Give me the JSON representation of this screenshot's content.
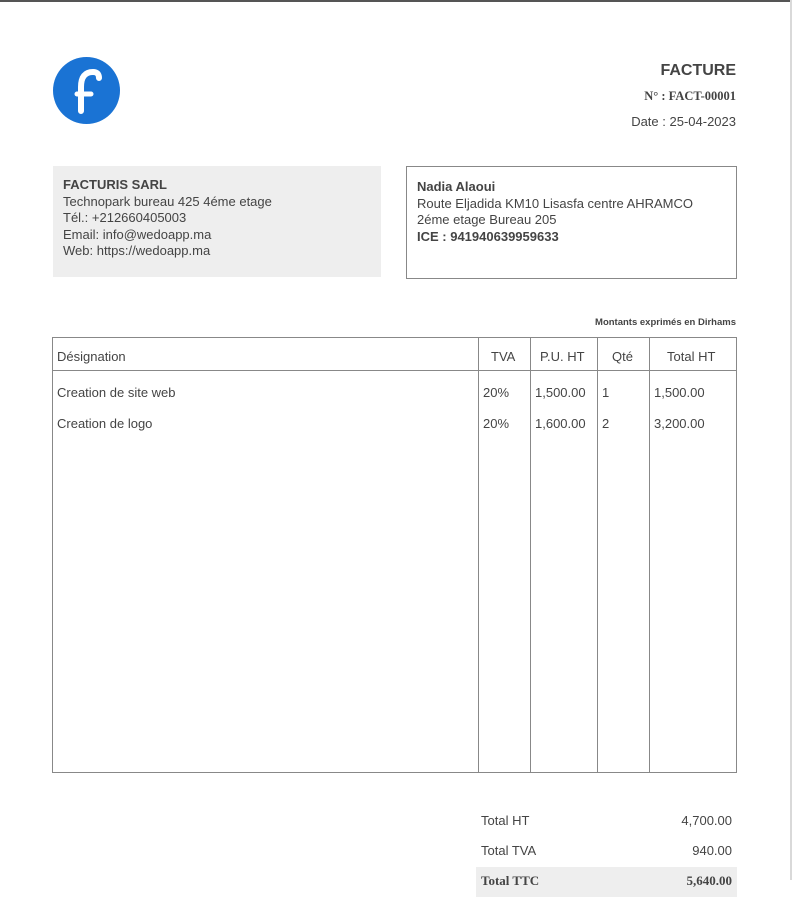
{
  "logo": {
    "letter": "f",
    "color": "#1a73d4"
  },
  "document": {
    "title": "FACTURE",
    "number": "N° : FACT-00001",
    "date_label": "Date :",
    "date_value": "25-04-2023"
  },
  "seller": {
    "name": "FACTURIS SARL",
    "address": "Technopark bureau 425 4éme etage",
    "phone": "Tél.: +212660405003",
    "email": "Email: info@wedoapp.ma",
    "web": "Web: https://wedoapp.ma"
  },
  "buyer": {
    "name": "Nadia Alaoui",
    "address_line1": "Route Eljadida KM10 Lisasfa centre AHRAMCO",
    "address_line2": "2éme etage Bureau 205",
    "ice": "ICE : 941940639959633"
  },
  "currency_note": "Montants exprimés en Dirhams",
  "table": {
    "headers": {
      "designation": "Désignation",
      "tva": "TVA",
      "unit_price": "P.U. HT",
      "quantity": "Qté",
      "total_ht": "Total HT"
    },
    "rows": [
      {
        "designation": "Creation de site web",
        "tva": "20%",
        "unit_price": "1,500.00",
        "quantity": "1",
        "total_ht": "1,500.00"
      },
      {
        "designation": "Creation de logo",
        "tva": "20%",
        "unit_price": "1,600.00",
        "quantity": "2",
        "total_ht": "3,200.00"
      }
    ]
  },
  "totals": {
    "total_ht_label": "Total HT",
    "total_ht_value": "4,700.00",
    "total_tva_label": "Total TVA",
    "total_tva_value": "940.00",
    "total_ttc_label": "Total TTC",
    "total_ttc_value": "5,640.00"
  }
}
